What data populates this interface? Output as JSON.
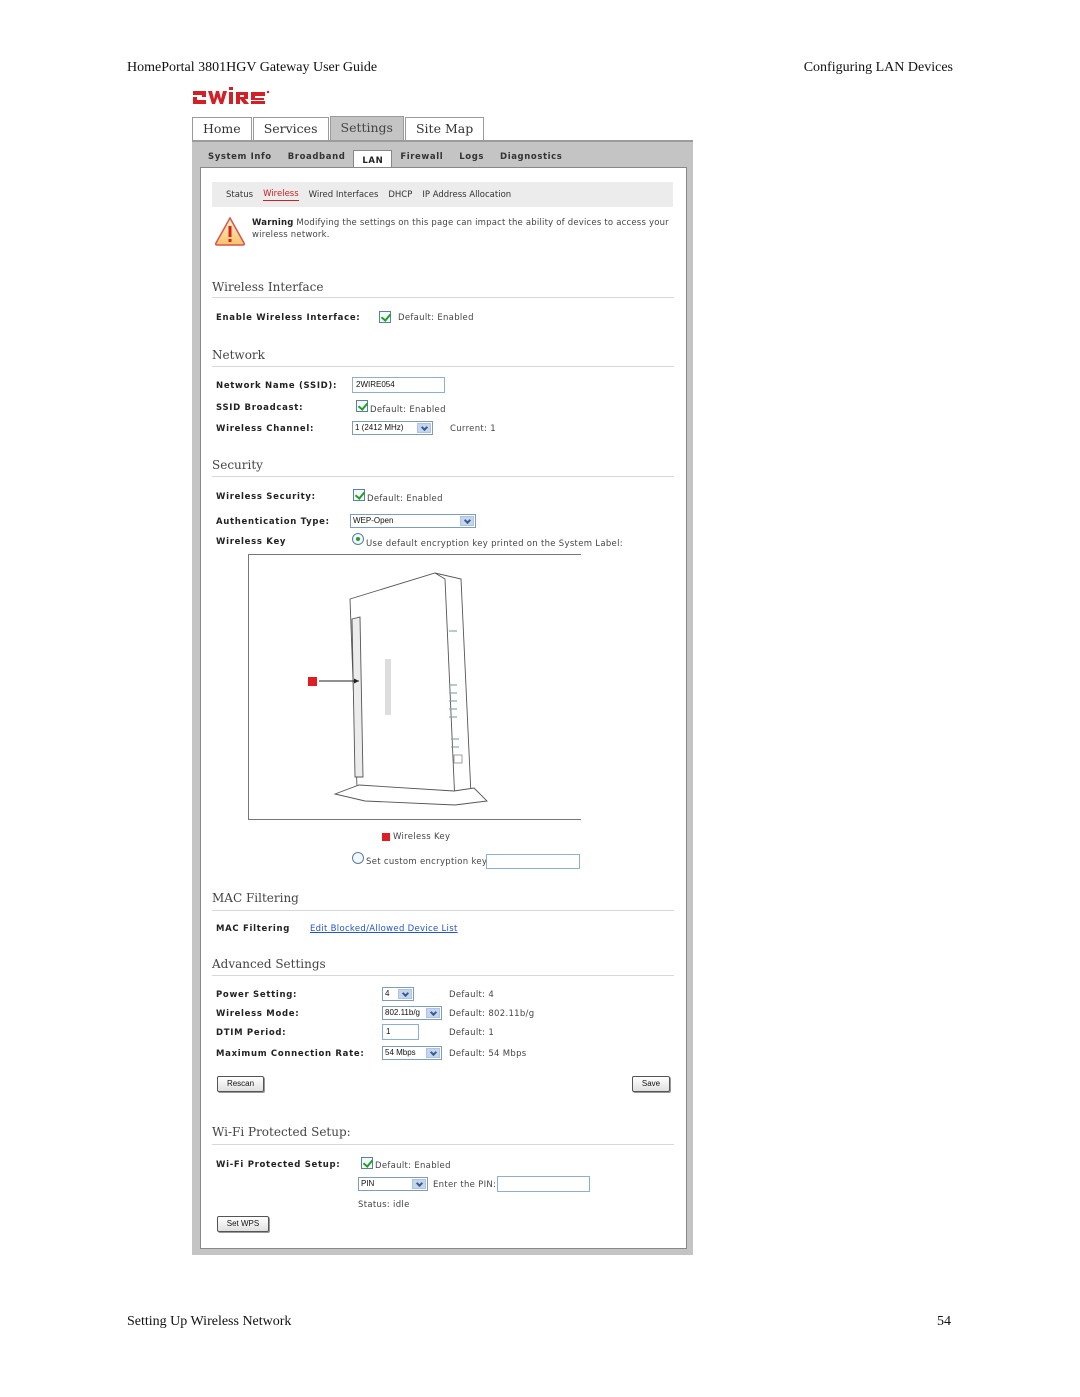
{
  "document": {
    "header_left": "HomePortal 3801HGV Gateway User Guide",
    "header_right": "Configuring LAN Devices",
    "footer_left": "Setting Up Wireless Network",
    "page_number": "54"
  },
  "brand": {
    "logo_text": "2WIRE",
    "logo_color": "#d41f26"
  },
  "top_tabs": [
    {
      "label": "Home",
      "active": false
    },
    {
      "label": "Services",
      "active": false
    },
    {
      "label": "Settings",
      "active": true
    },
    {
      "label": "Site Map",
      "active": false
    }
  ],
  "sub_tabs": [
    {
      "label": "System Info",
      "active": false
    },
    {
      "label": "Broadband",
      "active": false
    },
    {
      "label": "LAN",
      "active": true
    },
    {
      "label": "Firewall",
      "active": false
    },
    {
      "label": "Logs",
      "active": false
    },
    {
      "label": "Diagnostics",
      "active": false
    }
  ],
  "section_nav": [
    {
      "label": "Status",
      "active": false
    },
    {
      "label": "Wireless",
      "active": true
    },
    {
      "label": "Wired Interfaces",
      "active": false
    },
    {
      "label": "DHCP",
      "active": false
    },
    {
      "label": "IP Address Allocation",
      "active": false
    }
  ],
  "warning": {
    "icon": "warning-triangle-icon",
    "title": "Warning",
    "text": "Modifying the settings on this page can impact the ability of devices to access your wireless network."
  },
  "wireless_interface": {
    "title": "Wireless Interface",
    "enable_label": "Enable Wireless Interface:",
    "enable_checked": true,
    "enable_default": "Default: Enabled"
  },
  "network": {
    "title": "Network",
    "ssid_label": "Network Name (SSID):",
    "ssid_value": "2WIRE054",
    "broadcast_label": "SSID Broadcast:",
    "broadcast_checked": true,
    "broadcast_default": "Default: Enabled",
    "channel_label": "Wireless Channel:",
    "channel_value": "1 (2412 MHz)",
    "channel_current": "Current: 1"
  },
  "security": {
    "title": "Security",
    "wireless_security_label": "Wireless Security:",
    "wireless_security_checked": true,
    "wireless_security_default": "Default: Enabled",
    "auth_label": "Authentication Type:",
    "auth_value": "WEP-Open",
    "key_label": "Wireless Key",
    "use_default_key_label": "Use default encryption key printed on the System Label:",
    "use_default_key_selected": true,
    "legend_label": "Wireless Key",
    "custom_key_label": "Set custom encryption key:",
    "custom_key_selected": false,
    "custom_key_value": ""
  },
  "mac_filtering": {
    "title": "MAC Filtering",
    "label": "MAC Filtering",
    "link_text": "Edit Blocked/Allowed Device List"
  },
  "advanced": {
    "title": "Advanced Settings",
    "power_label": "Power Setting:",
    "power_value": "4",
    "power_default": "Default: 4",
    "mode_label": "Wireless Mode:",
    "mode_value": "802.11b/g",
    "mode_default": "Default: 802.11b/g",
    "dtim_label": "DTIM Period:",
    "dtim_value": "1",
    "dtim_default": "Default: 1",
    "rate_label": "Maximum Connection Rate:",
    "rate_value": "54 Mbps",
    "rate_default": "Default: 54 Mbps",
    "rescan_label": "Rescan",
    "save_label": "Save"
  },
  "wps": {
    "title": "Wi-Fi Protected Setup:",
    "label": "Wi-Fi Protected Setup:",
    "checked": true,
    "default": "Default: Enabled",
    "method_value": "PIN",
    "pin_label": "Enter the PIN:",
    "pin_value": "",
    "status": "Status: idle",
    "set_wps_label": "Set WPS"
  }
}
